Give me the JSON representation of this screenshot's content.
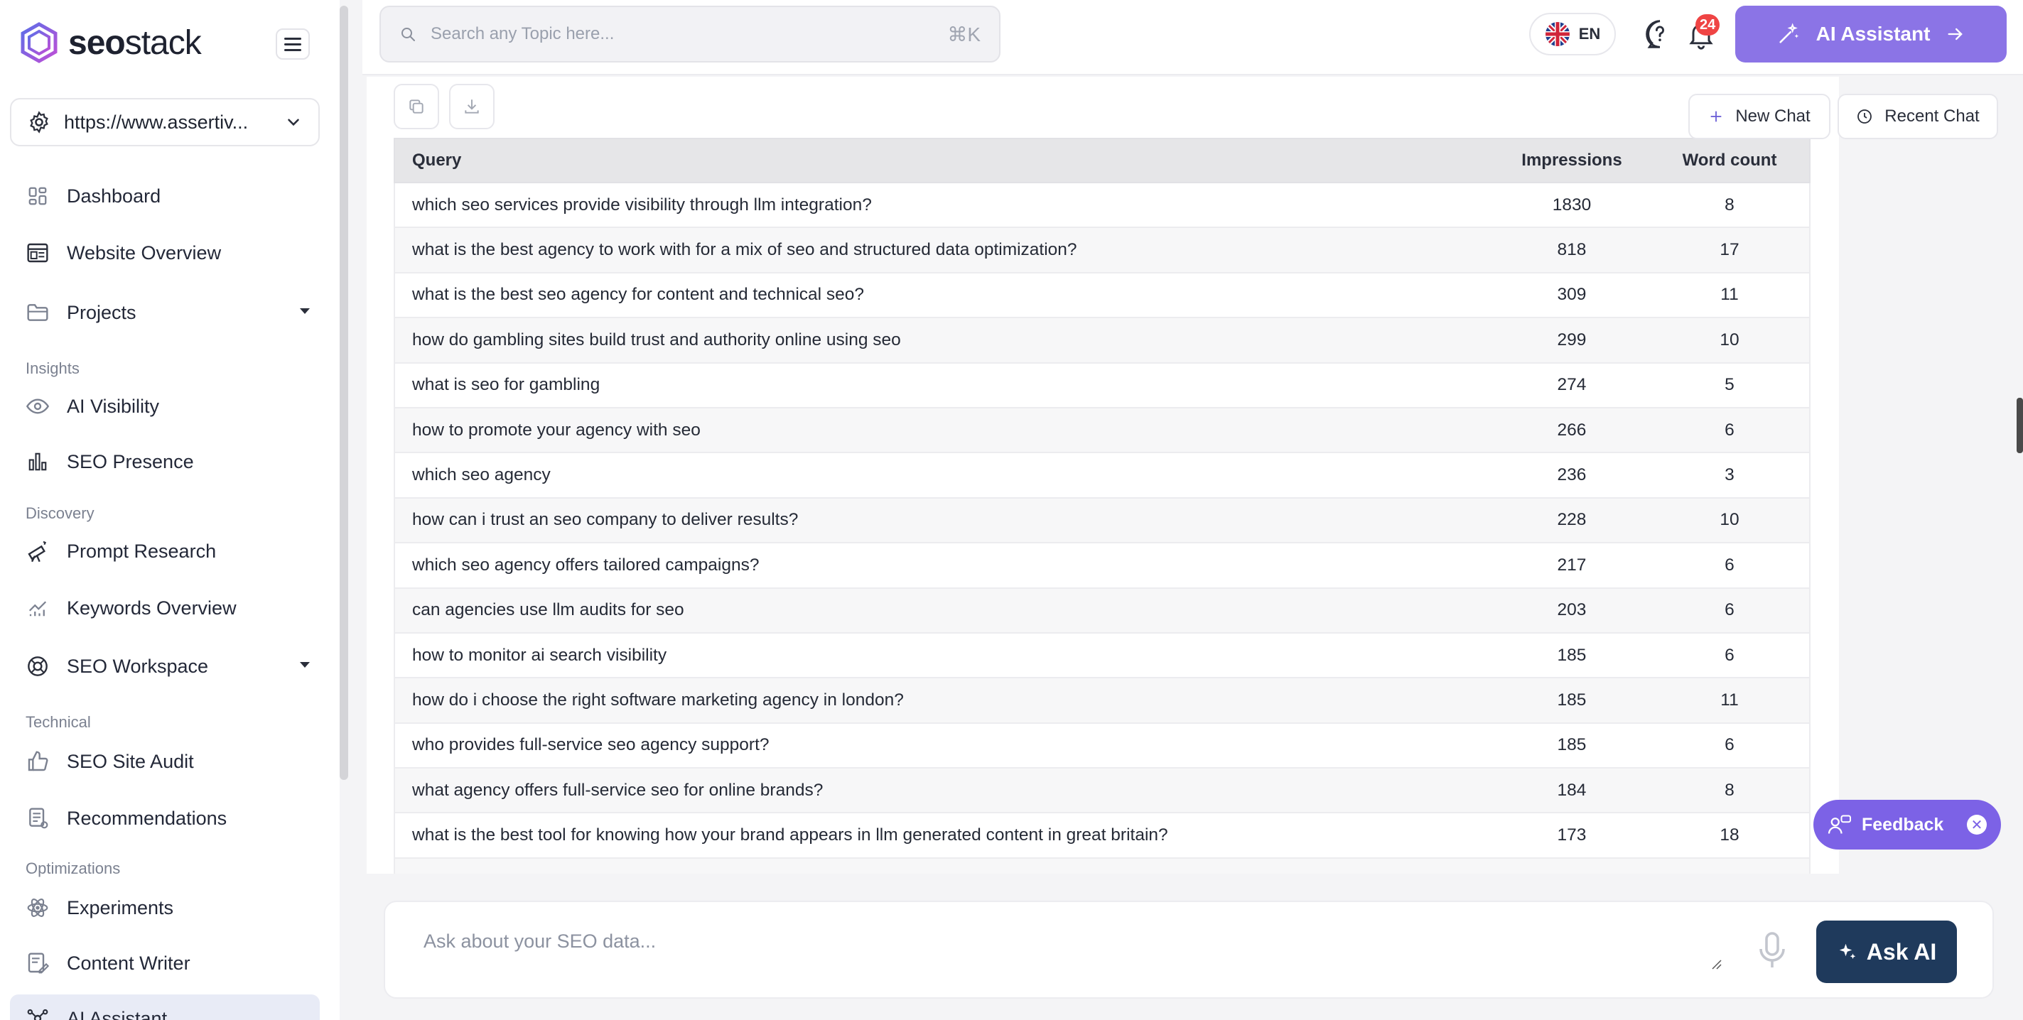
{
  "brand": {
    "name_bold": "seo",
    "name_light": "stack"
  },
  "site_selector": {
    "value": "https://www.assertiv..."
  },
  "nav": {
    "dashboard": "Dashboard",
    "website_overview": "Website Overview",
    "projects": "Projects",
    "section_insights": "Insights",
    "ai_visibility": "AI Visibility",
    "seo_presence": "SEO Presence",
    "section_discovery": "Discovery",
    "prompt_research": "Prompt Research",
    "keywords_overview": "Keywords Overview",
    "seo_workspace": "SEO Workspace",
    "section_technical": "Technical",
    "seo_site_audit": "SEO Site Audit",
    "recommendations": "Recommendations",
    "section_optimizations": "Optimizations",
    "experiments": "Experiments",
    "content_writer": "Content Writer",
    "ai_assistant": "AI Assistant"
  },
  "topbar": {
    "search_placeholder": "Search any Topic here...",
    "search_shortcut": "⌘K",
    "language": "EN",
    "notification_count": "24",
    "ai_assistant_label": "AI Assistant"
  },
  "chat_actions": {
    "new_chat": "New Chat",
    "recent_chat": "Recent Chat"
  },
  "table": {
    "headers": {
      "query": "Query",
      "impressions": "Impressions",
      "word_count": "Word count"
    },
    "rows": [
      {
        "query": "which seo services provide visibility through llm integration?",
        "impressions": "1830",
        "word_count": "8"
      },
      {
        "query": "what is the best agency to work with for a mix of seo and structured data optimization?",
        "impressions": "818",
        "word_count": "17"
      },
      {
        "query": "what is the best seo agency for content and technical seo?",
        "impressions": "309",
        "word_count": "11"
      },
      {
        "query": "how do gambling sites build trust and authority online using seo",
        "impressions": "299",
        "word_count": "10"
      },
      {
        "query": "what is seo for gambling",
        "impressions": "274",
        "word_count": "5"
      },
      {
        "query": "how to promote your agency with seo",
        "impressions": "266",
        "word_count": "6"
      },
      {
        "query": "which seo agency",
        "impressions": "236",
        "word_count": "3"
      },
      {
        "query": "how can i trust an seo company to deliver results?",
        "impressions": "228",
        "word_count": "10"
      },
      {
        "query": "which seo agency offers tailored campaigns?",
        "impressions": "217",
        "word_count": "6"
      },
      {
        "query": "can agencies use llm audits for seo",
        "impressions": "203",
        "word_count": "6"
      },
      {
        "query": "how to monitor ai search visibility",
        "impressions": "185",
        "word_count": "6"
      },
      {
        "query": "how do i choose the right software marketing agency in london?",
        "impressions": "185",
        "word_count": "11"
      },
      {
        "query": "who provides full-service seo agency support?",
        "impressions": "185",
        "word_count": "6"
      },
      {
        "query": "what agency offers full-service seo for online brands?",
        "impressions": "184",
        "word_count": "8"
      },
      {
        "query": "what is the best tool for knowing how your brand appears in llm generated content in great britain?",
        "impressions": "173",
        "word_count": "18"
      },
      {
        "query": "",
        "impressions": "",
        "word_count": ""
      }
    ]
  },
  "feedback": {
    "label": "Feedback",
    "close": "✕"
  },
  "composer": {
    "placeholder": "Ask about your SEO data...",
    "ask_label": "Ask AI"
  },
  "colors": {
    "accent": "#8b74e6",
    "feedback": "#7c62e6",
    "ask_button": "#1f3a5c",
    "badge": "#ef4444"
  }
}
